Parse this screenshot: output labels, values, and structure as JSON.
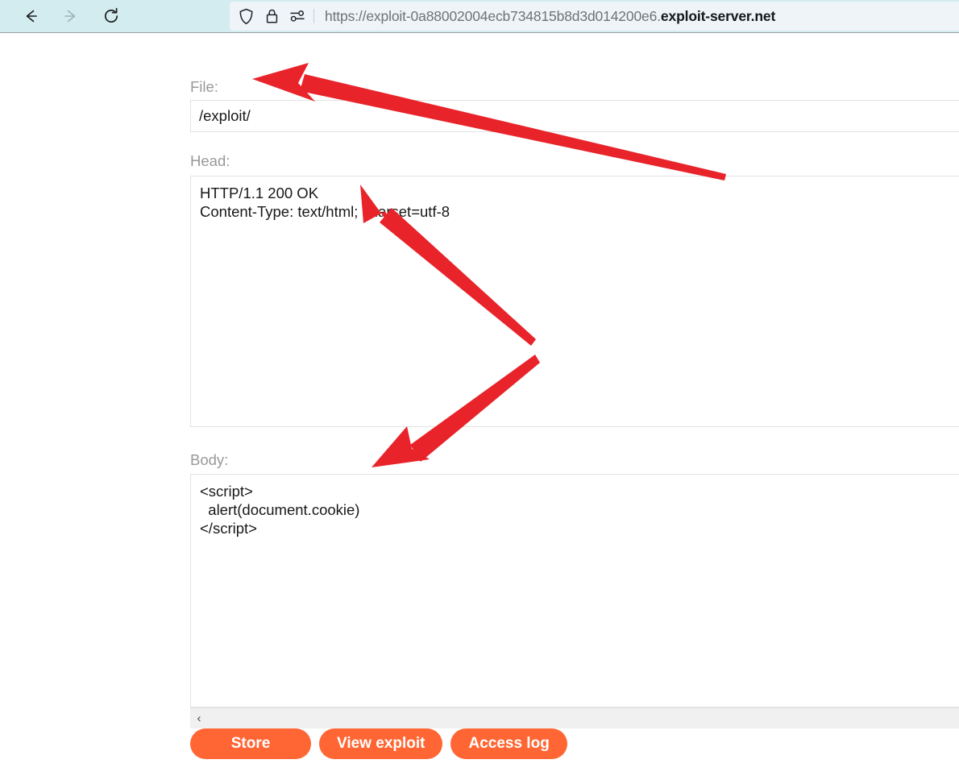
{
  "browser": {
    "nav": {
      "back_label": "Back",
      "forward_label": "Forward",
      "reload_label": "Reload"
    },
    "url_prefix": "https://exploit-0a88002004ecb734815b8d3d014200e6.",
    "url_host": "exploit-server.net",
    "icons": {
      "shield": "shield-icon",
      "lock": "lock-icon",
      "permissions": "permissions-icon"
    }
  },
  "form": {
    "file": {
      "label": "File:",
      "value": "/exploit/",
      "placeholder": ""
    },
    "head": {
      "label": "Head:",
      "value": "HTTP/1.1 200 OK\nContent-Type: text/html; charset=utf-8",
      "placeholder": ""
    },
    "body": {
      "label": "Body:",
      "value": "<script>\n  alert(document.cookie)\n</script>",
      "placeholder": ""
    },
    "scrollbar": {
      "left_arrow_glyph": "‹"
    }
  },
  "buttons": [
    {
      "label": "Store",
      "name": "store-button"
    },
    {
      "label": "View exploit",
      "name": "view-exploit-button"
    },
    {
      "label": "Access log",
      "name": "access-log-button"
    }
  ],
  "colors": {
    "chrome_background": "#d3ecef",
    "urlbar_background": "#eef4f8",
    "button_orange": "#ff6633",
    "annotation_red": "#e8232a",
    "label_gray": "#999999"
  },
  "annotations": {
    "arrow_count": 3,
    "arrow_color": "#e8232a"
  }
}
